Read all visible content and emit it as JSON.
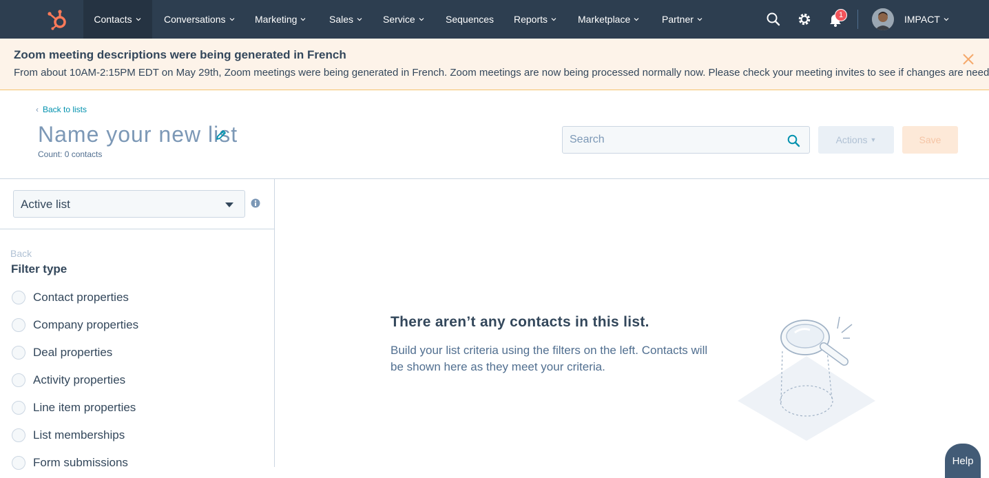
{
  "topnav": {
    "items": [
      {
        "label": "Contacts",
        "has_caret": true,
        "active": true
      },
      {
        "label": "Conversations",
        "has_caret": true
      },
      {
        "label": "Marketing",
        "has_caret": true
      },
      {
        "label": "Sales",
        "has_caret": true
      },
      {
        "label": "Service",
        "has_caret": true
      },
      {
        "label": "Sequences",
        "has_caret": false
      },
      {
        "label": "Reports",
        "has_caret": true
      },
      {
        "label": "Marketplace",
        "has_caret": true
      },
      {
        "label": "Partner",
        "has_caret": true
      }
    ],
    "notification_count": "1",
    "account_label": "IMPACT",
    "icons": [
      "hubspot-logo",
      "search-icon",
      "gear-icon",
      "bell-icon",
      "avatar"
    ]
  },
  "banner": {
    "title": "Zoom meeting descriptions were being generated in French",
    "body": "From about 10AM-2:15PM EDT on May 29th, Zoom meetings were being generated in French. Zoom meetings are now being processed normally now. Please check your meeting invites to see if changes are needed."
  },
  "header": {
    "back_link": "Back to lists",
    "list_name_placeholder": "Name your new list",
    "count": "Count: 0 contacts",
    "search_placeholder": "Search",
    "actions_label": "Actions",
    "save_label": "Save"
  },
  "left_panel": {
    "list_type": "Active list",
    "back_label": "Back",
    "filter_heading": "Filter type",
    "filter_options": [
      "Contact properties",
      "Company properties",
      "Deal properties",
      "Activity properties",
      "Line item properties",
      "List memberships",
      "Form submissions"
    ]
  },
  "empty_state": {
    "title": "There aren’t any contacts in this list.",
    "body": "Build your list criteria using the filters on the left. Contacts will be shown here as they meet your criteria."
  },
  "help_label": "Help",
  "colors": {
    "nav_bg": "#2d3e50",
    "brand_orange": "#ff7a59",
    "link": "#0091ae",
    "banner_bg": "#fdf3e9",
    "text": "#33475b"
  }
}
